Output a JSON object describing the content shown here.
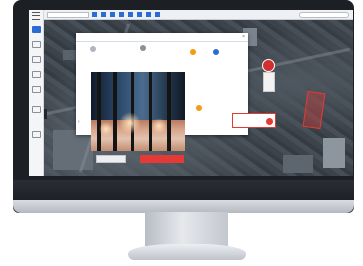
{
  "colors": {
    "accent": "#2b6cd4",
    "alert": "#e53935",
    "sidebar_bg": "#f4f5f7",
    "toolbar_bg": "#eef0f3",
    "dialog_bg": "#ffffff"
  },
  "sidebar": {
    "menu_icon": "hamburger-icon",
    "items": [
      {
        "icon": "map-icon",
        "label": "",
        "active": true
      },
      {
        "icon": "layers-icon",
        "label": ""
      },
      {
        "icon": "list-icon",
        "label": ""
      },
      {
        "icon": "camera-icon",
        "label": ""
      },
      {
        "icon": "document-icon",
        "label": ""
      },
      {
        "icon": "chart-icon",
        "label": ""
      },
      {
        "icon": "settings-icon",
        "label": ""
      }
    ]
  },
  "toolbar": {
    "select_value": "",
    "filters": [
      "",
      "",
      "",
      "",
      "",
      "",
      "",
      ""
    ],
    "search_placeholder": ""
  },
  "dialog": {
    "title": "",
    "close_glyph": "×",
    "columns": [
      "",
      "",
      ""
    ]
  },
  "actions": {
    "secondary_label": "",
    "primary_label": ""
  }
}
